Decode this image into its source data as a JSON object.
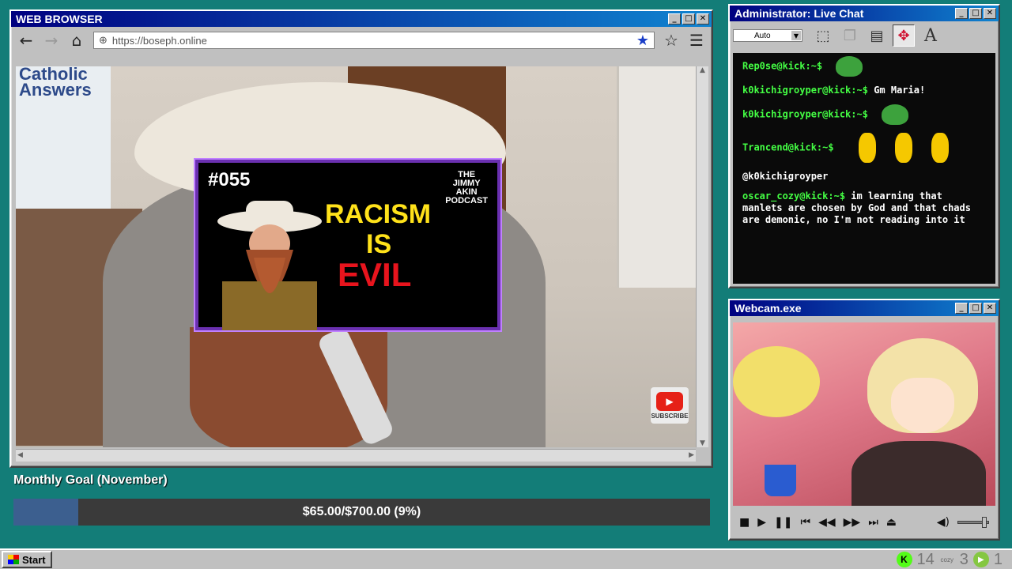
{
  "browser": {
    "title": "WEB BROWSER",
    "url": "https://boseph.online",
    "controls": {
      "minimize": "_",
      "maximize": "□",
      "close": "✕"
    }
  },
  "video": {
    "channel_logo": "Catholic\nAnswers",
    "youtube_subscribe": "SUBSCRIBE",
    "thumbnail": {
      "episode": "#055",
      "brand": "THE\nJIMMY\nAKIN\nPODCAST",
      "line1": "RACISM",
      "line2": "IS",
      "line3": "EVIL"
    }
  },
  "goal": {
    "label": "Monthly Goal (November)",
    "text": "$65.00/$700.00 (9%)",
    "current": 65,
    "target": 700,
    "percent": 9,
    "fill_color": "#3c5f8f"
  },
  "chat": {
    "title": "Administrator: Live Chat",
    "zoom": "Auto",
    "messages": [
      {
        "user": "Rep0se@kick:~$",
        "text": "",
        "emote": "pepe-emote"
      },
      {
        "user": "k0kichigroyper@kick:~$",
        "text": "Gm Maria!",
        "emote": ""
      },
      {
        "user": "k0kichigroyper@kick:~$",
        "text": "",
        "emote": "pepe-hat-emote"
      },
      {
        "user": "Trancend@kick:~$",
        "text": "",
        "emote": "raincoat-emote"
      },
      {
        "user": "",
        "text": "@k0kichigroyper",
        "emote": ""
      },
      {
        "user": "oscar_cozy@kick:~$",
        "text": "im learning that manlets are chosen by God and that chads are demonic, no I'm not reading into it",
        "emote": ""
      }
    ]
  },
  "webcam": {
    "title": "Webcam.exe"
  },
  "taskbar": {
    "start": "Start",
    "kick_count": "14",
    "cozy_label": "cozy",
    "rumble_count_a": "3",
    "rumble_count_b": "1"
  },
  "colors": {
    "desktop": "#137d78",
    "titlebar": "#000080",
    "chat_user": "#44ff44",
    "accent_star": "#1a3ec8"
  }
}
